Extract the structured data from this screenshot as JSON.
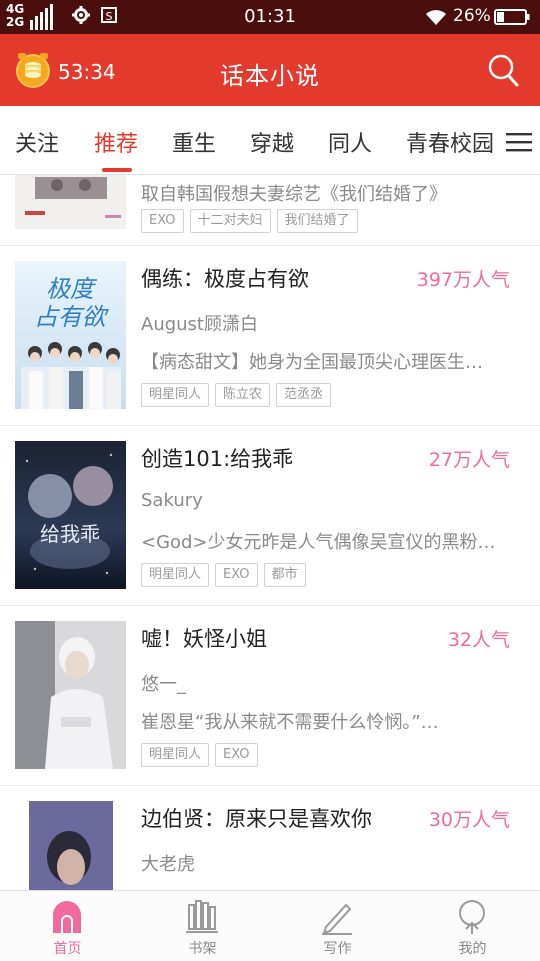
{
  "status_bar": {
    "network_top": "4G",
    "network_bottom": "2G",
    "time": "01:31",
    "battery_percent": "26%",
    "battery_level": 0.26
  },
  "header": {
    "countdown": "53:34",
    "title": "话本小说",
    "accent_color": "#e43a2e"
  },
  "tabs": [
    {
      "label": "关注",
      "active": false
    },
    {
      "label": "推荐",
      "active": true
    },
    {
      "label": "重生",
      "active": false
    },
    {
      "label": "穿越",
      "active": false
    },
    {
      "label": "同人",
      "active": false
    },
    {
      "label": "青春校园",
      "active": false
    }
  ],
  "books": [
    {
      "title": "",
      "description": "取自韩国假想夫妻综艺《我们结婚了》",
      "tags": [
        "EXO",
        "十二对夫妇",
        "我们结婚了"
      ]
    },
    {
      "title": "偶练：极度占有欲",
      "popularity": "397万人气",
      "author": "August顾潇白",
      "description": "【病态甜文】她身为全国最顶尖心理医生…",
      "tags": [
        "明星同人",
        "陈立农",
        "范丞丞"
      ],
      "cover_text": "极度占有欲"
    },
    {
      "title": "创造101:给我乖",
      "popularity": "27万人气",
      "author": "Sakury",
      "description": "<God>少女元昨是人气偶像吴宣仪的黑粉…",
      "tags": [
        "明星同人",
        "EXO",
        "都市"
      ],
      "cover_text": "给我乖"
    },
    {
      "title": "嘘！妖怪小姐",
      "popularity": "32人气",
      "author": "悠一_",
      "description": "崔恩星“我从来就不需要什么怜悯。”…",
      "tags": [
        "明星同人",
        "EXO"
      ]
    },
    {
      "title": "边伯贤：原来只是喜欢你",
      "popularity": "30万人气",
      "author": "大老虎",
      "description": "",
      "tags": []
    }
  ],
  "bottom_nav": [
    {
      "label": "首页",
      "icon": "home-icon",
      "active": true
    },
    {
      "label": "书架",
      "icon": "bookshelf-icon",
      "active": false
    },
    {
      "label": "写作",
      "icon": "pen-icon",
      "active": false
    },
    {
      "label": "我的",
      "icon": "profile-icon",
      "active": false
    }
  ],
  "colors": {
    "popularity": "#f06aa0",
    "active_nav": "#f06aa0"
  }
}
